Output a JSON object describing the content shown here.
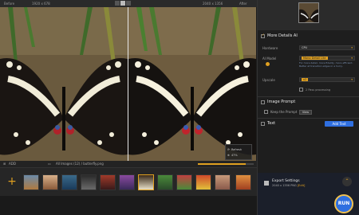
{
  "topbar": {
    "before_label": "Before",
    "before_size": "1920 x 678",
    "after_size": "2040 x 1356",
    "after_label": "After"
  },
  "zoom_popup": {
    "refresh_label": "Refresh",
    "zoom_value": "47%"
  },
  "stripbar": {
    "add_label": "ADD",
    "path": "All Images (12) / butterfly.png"
  },
  "progress": {
    "fraction": 0.85
  },
  "panel": {
    "more_details": "More Details AI",
    "hardware_label": "Hardware",
    "hardware_value": "CPU",
    "ai_model_label": "AI Model",
    "ai_model_value": "Mono Detail Lite",
    "ai_model_hint": "For more detail, more fidelity, more efficient. Better at transition edges in a hurry.",
    "upscale_label": "Upscale",
    "upscale_value": "x2",
    "pass_label": "2 Pass processing",
    "image_prompt": "Image Prompt",
    "keep_prompt": "Keep the Prompt",
    "view_btn": "View",
    "text_section": "Text",
    "add_text_btn": "Add Text"
  },
  "export": {
    "title": "Export Settings",
    "details": "2040 x 1356  PNG",
    "link": "[Edit]"
  },
  "run_label": "RUN",
  "colors": {
    "accent": "#e0a020",
    "blue": "#2f6fe0"
  }
}
